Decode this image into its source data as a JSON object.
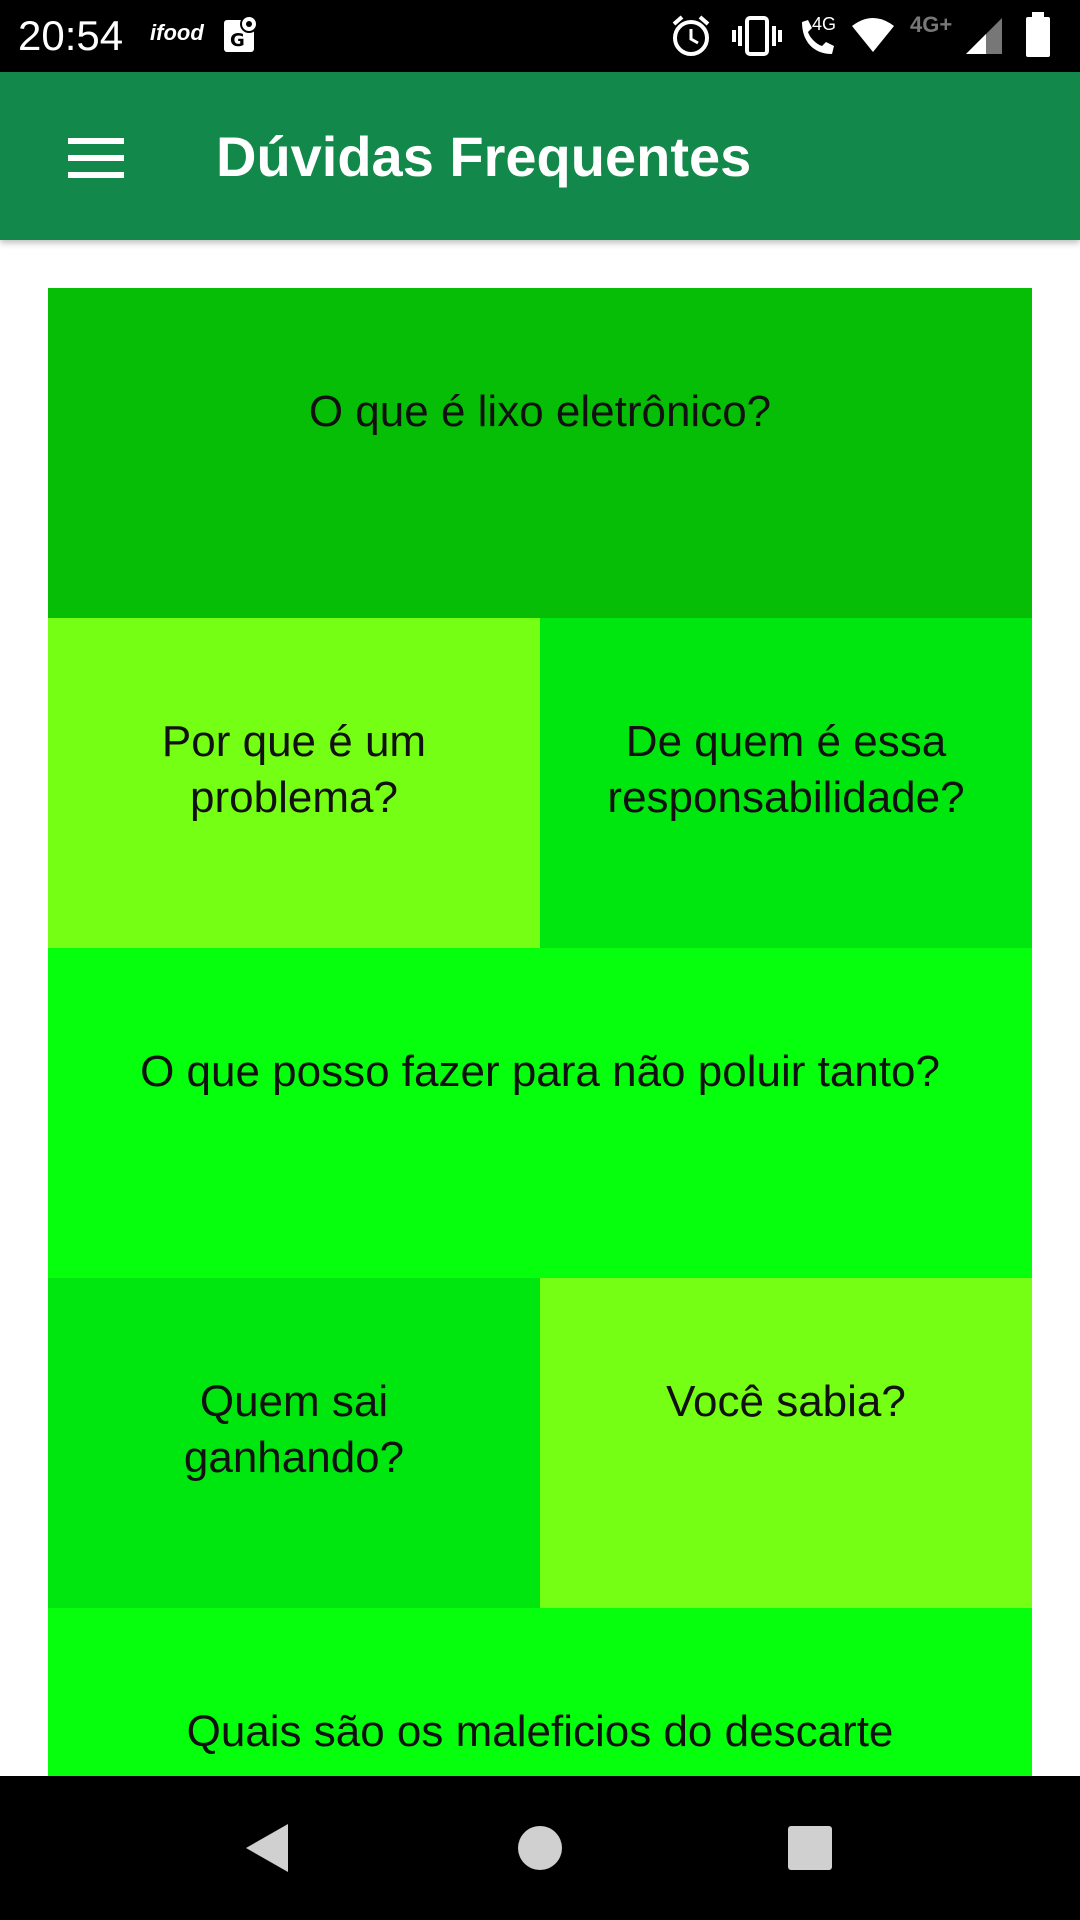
{
  "status_bar": {
    "time": "20:54",
    "app_notification": "ifood",
    "icons": [
      "maps-icon",
      "alarm-icon",
      "vibrate-icon",
      "volte-call-icon",
      "wifi-icon",
      "signal-icon",
      "battery-icon"
    ],
    "network_label": "4G",
    "network_label_2": "4G+"
  },
  "app_bar": {
    "title": "Dúvidas Frequentes",
    "menu_icon": "hamburger-menu-icon",
    "color": "#12894a"
  },
  "faq_tiles": [
    {
      "label": "O que é lixo eletrônico?",
      "color": "#05be05"
    },
    {
      "label": "Por que é um problema?",
      "color": "#74ff14"
    },
    {
      "label": "De quem é essa responsabilidade?",
      "color": "#00e70f"
    },
    {
      "label": "O que posso fazer para não poluir tanto?",
      "color": "#05ff0d"
    },
    {
      "label": "Quem sai ganhando?",
      "color": "#00e70f"
    },
    {
      "label": "Você sabia?",
      "color": "#74ff14"
    },
    {
      "label": "Quais são os maleficios do descarte",
      "color": "#05ff0d"
    }
  ],
  "nav_bar": {
    "back": "back-icon",
    "home": "home-icon",
    "recents": "recents-icon"
  }
}
